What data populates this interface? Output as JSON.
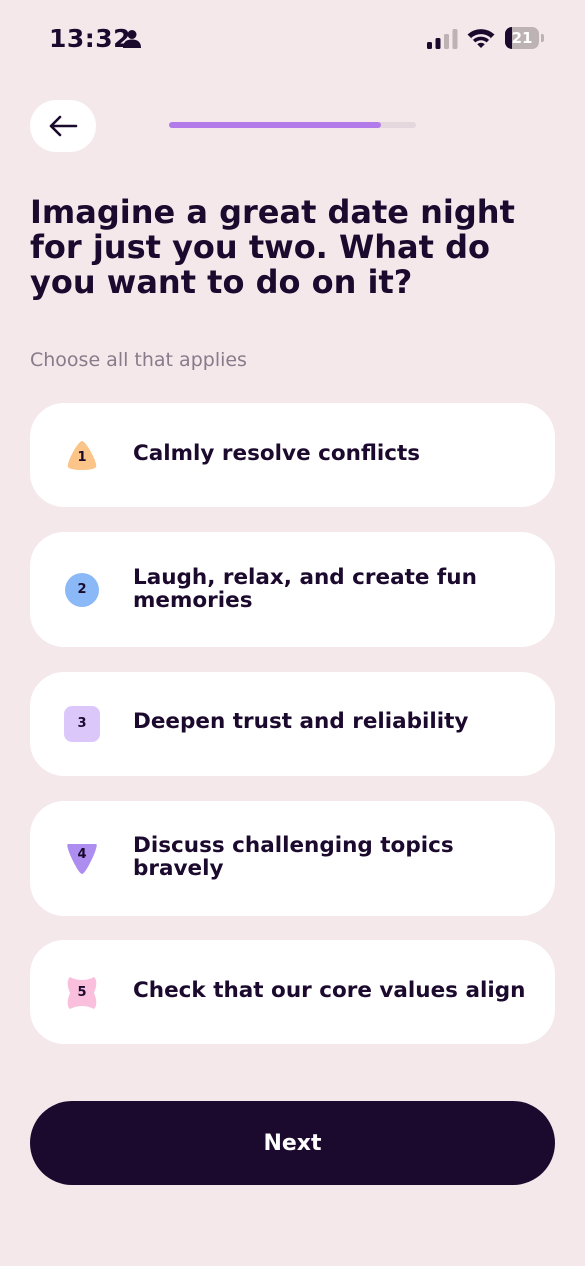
{
  "status_bar": {
    "time": "13:32",
    "battery_level": "21"
  },
  "progress": {
    "fraction": 0.86
  },
  "question": {
    "title": "Imagine a great date night for just you two. What do you want to do on it?",
    "subtitle": "Choose all that applies"
  },
  "options": [
    {
      "number": "1",
      "label": "Calmly resolve conflicts",
      "badge_shape": "rounded-triangle",
      "badge_color": "#fbc489"
    },
    {
      "number": "2",
      "label": "Laugh, relax, and create fun memories",
      "badge_shape": "circle",
      "badge_color": "#8bb8f7"
    },
    {
      "number": "3",
      "label": "Deepen trust and reliability",
      "badge_shape": "rounded-square",
      "badge_color": "#dcc7fb"
    },
    {
      "number": "4",
      "label": "Discuss challenging topics bravely",
      "badge_shape": "inverted-triangle",
      "badge_color": "#ad8ef0"
    },
    {
      "number": "5",
      "label": "Check that our core values align",
      "badge_shape": "wavy-blob",
      "badge_color": "#f9bfdc"
    }
  ],
  "next_button": {
    "label": "Next"
  },
  "colors": {
    "background": "#f4e8eb",
    "text_primary": "#1b0a2e",
    "progress_accent": "#b27be9",
    "card": "#ffffff"
  }
}
